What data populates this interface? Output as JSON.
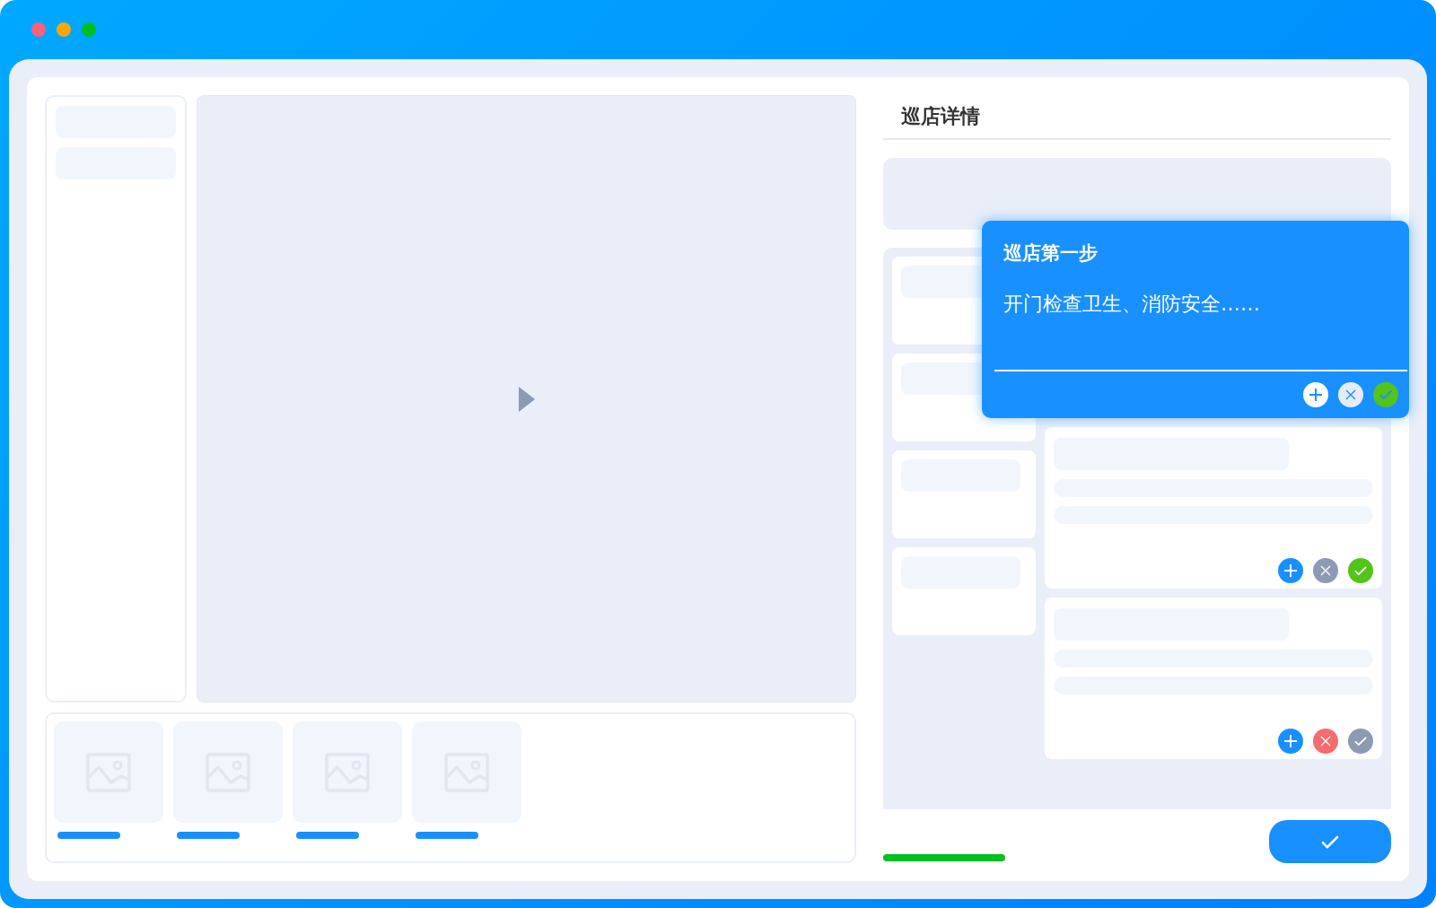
{
  "panel": {
    "title": "巡店详情"
  },
  "popup": {
    "title": "巡店第一步",
    "description": "开门检查卫生、消防安全……",
    "approved": true,
    "rejected": false
  },
  "step_cards": [
    {
      "approved": true,
      "rejected": false
    },
    {
      "approved": false,
      "rejected": true
    }
  ]
}
